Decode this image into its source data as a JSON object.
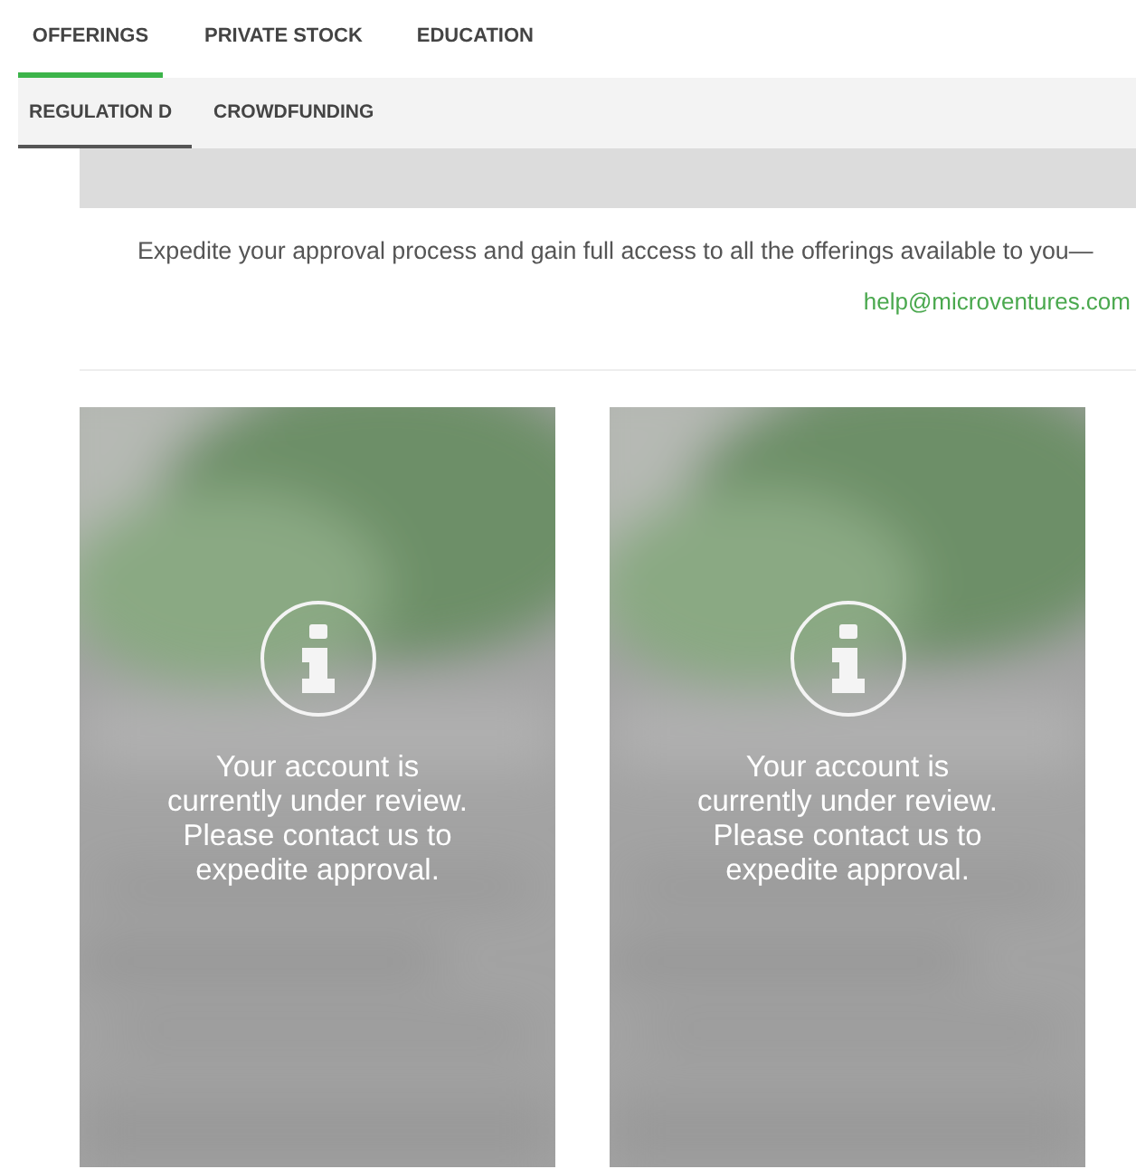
{
  "tabs": [
    {
      "label": "OFFERINGS",
      "selected": true
    },
    {
      "label": "PRIVATE STOCK",
      "selected": false
    },
    {
      "label": "EDUCATION",
      "selected": false
    }
  ],
  "subtabs": [
    {
      "label": "REGULATION D",
      "selected": true
    },
    {
      "label": "CROWDFUNDING",
      "selected": false
    }
  ],
  "intro": "Expedite your approval process and gain full access to all the offerings available to you—",
  "email": "help@microventures.com",
  "cards": [
    {
      "kind": "picture",
      "message": "Your account is currently under review. Please contact us to expedite approval."
    },
    {
      "kind": "picture",
      "message": "Your account is currently under review. Please contact us to expedite approval."
    }
  ]
}
